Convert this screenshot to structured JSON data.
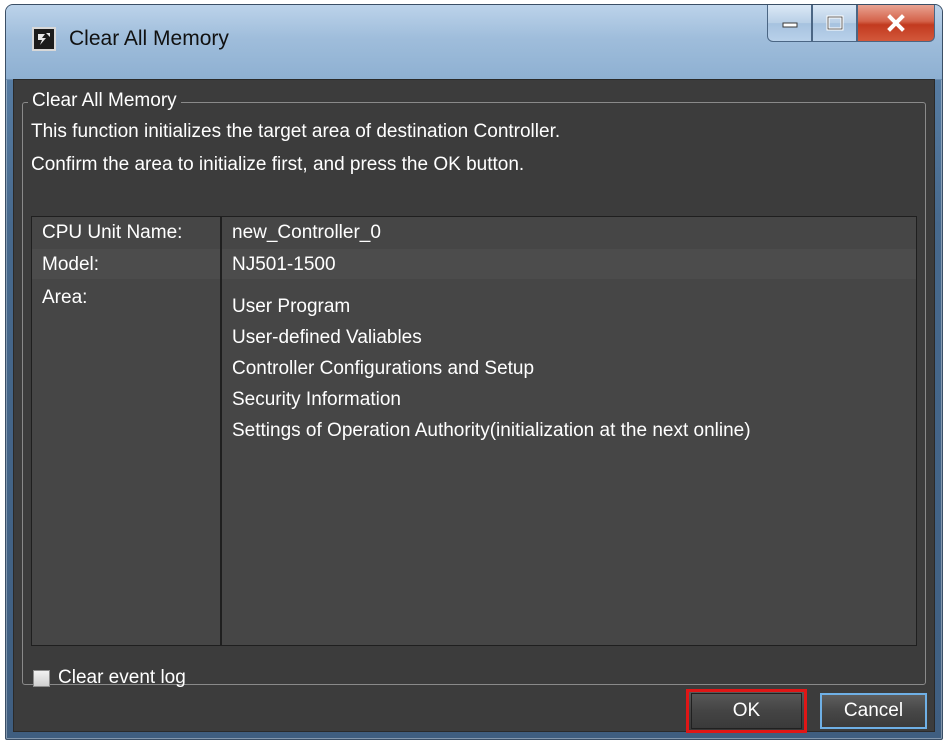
{
  "window": {
    "title": "Clear All Memory"
  },
  "titlebar_buttons": {
    "minimize_icon": "minimize-icon",
    "maximize_icon": "maximize-icon",
    "close_icon": "close-icon"
  },
  "group": {
    "title": "Clear All Memory",
    "description_line1": "This function initializes the target area of destination Controller.",
    "description_line2": "Confirm the area to initialize first, and press the OK button."
  },
  "info": {
    "cpu_unit_name_label": "CPU Unit Name:",
    "cpu_unit_name_value": "new_Controller_0",
    "model_label": "Model:",
    "model_value": "NJ501-1500",
    "area_label": "Area:",
    "area_items": [
      "User Program",
      "User-defined Valiables",
      "Controller Configurations and Setup",
      "Security Information",
      "Settings of Operation Authority(initialization at the next online)"
    ]
  },
  "options": {
    "clear_event_log_label": "Clear event log",
    "clear_event_log_checked": false
  },
  "buttons": {
    "ok_label": "OK",
    "cancel_label": "Cancel"
  },
  "colors": {
    "dialog_background": "#3c3c3c",
    "ok_highlight_border": "#e01616",
    "cancel_focus_border": "#6fb0e6"
  }
}
